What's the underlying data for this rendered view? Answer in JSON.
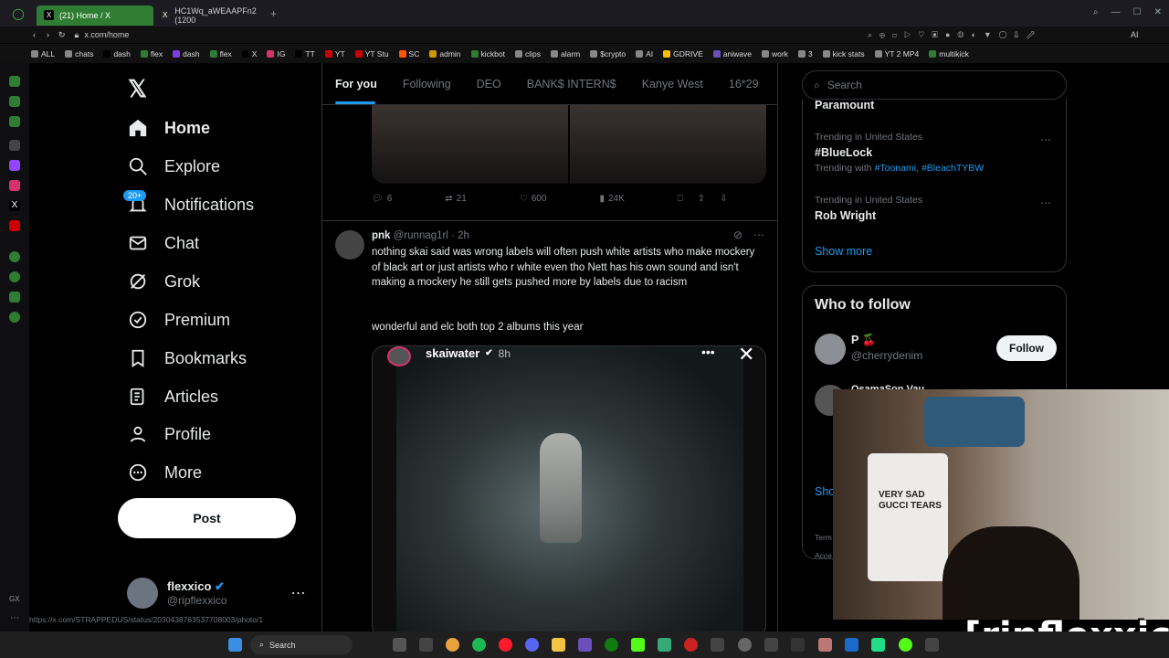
{
  "browser": {
    "tabs": [
      {
        "label": "(21) Home / X",
        "active": true
      },
      {
        "label": "HC1Wq_aWEAAPFn2 (1200",
        "active": false
      }
    ],
    "url": "x.com/home",
    "bookmarks": [
      "ALL",
      "chats",
      "dash",
      "flex",
      "dash",
      "flex",
      "X",
      "IG",
      "TT",
      "YT",
      "YT Stu",
      "SC",
      "admin",
      "kickbot",
      "clips",
      "alarm",
      "$crypto",
      "AI",
      "GDRIVE",
      "aniwave",
      "work",
      "3",
      "kick stats",
      "YT 2 MP4",
      "multikick"
    ],
    "status_url": "https://x.com/STRAPPEDUS/status/2030438763537708003/photo/1"
  },
  "nav": {
    "logo": "𝕏",
    "items": [
      {
        "label": "Home",
        "icon": "home-icon"
      },
      {
        "label": "Explore",
        "icon": "search-icon"
      },
      {
        "label": "Notifications",
        "icon": "bell-icon"
      },
      {
        "label": "Chat",
        "icon": "mail-icon"
      },
      {
        "label": "Grok",
        "icon": "grok-icon"
      },
      {
        "label": "Premium",
        "icon": "verified-icon"
      },
      {
        "label": "Bookmarks",
        "icon": "bookmark-icon"
      },
      {
        "label": "Articles",
        "icon": "article-icon"
      },
      {
        "label": "Profile",
        "icon": "person-icon"
      },
      {
        "label": "More",
        "icon": "more-icon"
      }
    ],
    "notif_badge": "20+",
    "post_label": "Post",
    "account": {
      "name": "flexxico",
      "handle": "@ripflexxico"
    }
  },
  "feed": {
    "tabs": [
      "For you",
      "Following",
      "DEO",
      "BANK$ INTERN$",
      "Kanye West",
      "16*29"
    ],
    "prev_actions": {
      "replies": "6",
      "reposts": "21",
      "likes": "600",
      "views": "24K"
    },
    "tweet": {
      "name": "pnk",
      "handle": "@runnag1rl",
      "time": "· 2h",
      "text": "nothing skai said was wrong  labels will often push white artists who make mockery of black art or just artists who r white  even tho Nett has his own sound and isn't making a mockery he still gets pushed more by labels due to racism",
      "text2": "wonderful and elc both top 2 albums this year",
      "story_user": "skaiwater",
      "story_time": "8h"
    }
  },
  "right": {
    "search_placeholder": "Search",
    "trend_cut": "Paramount",
    "trends": [
      {
        "context": "Trending in United States",
        "title": "#BlueLock",
        "with_prefix": "Trending with",
        "with_tags": "#Toonami, #BleachTYBW"
      },
      {
        "context": "Trending in United States",
        "title": "Rob Wright"
      }
    ],
    "show_more": "Show more",
    "who_to_follow": {
      "title": "Who to follow",
      "users": [
        {
          "name": "P 🍒",
          "handle": "@cherrydenim",
          "button": "Follow"
        },
        {
          "name": "OsamaSon Vau"
        }
      ],
      "show_more_cut": "Sho"
    },
    "footer": [
      "Term",
      "Acce"
    ]
  },
  "overlay": {
    "shirt_text": "VERY SAD\nGUCCI TEARS",
    "brand": "[ripflexxico]"
  },
  "taskbar": {
    "search_label": "Search"
  },
  "colors": {
    "accent": "#1d9bf0",
    "tab_active": "#2e7d32",
    "bg": "#000000"
  }
}
